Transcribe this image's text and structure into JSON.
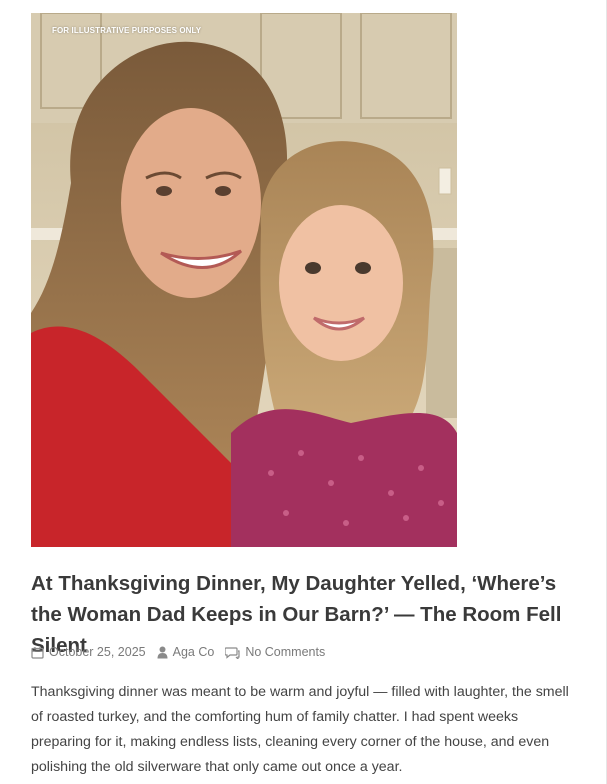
{
  "article": {
    "image_label": "FOR ILLUSTRATIVE PURPOSES ONLY",
    "title": "At Thanksgiving Dinner, My Daughter Yelled, ‘Where’s the Woman Dad Keeps in Our Barn?’ — The Room Fell Silent",
    "meta": {
      "date": "October 25, 2025",
      "author": "Aga Co",
      "comments": "No Comments"
    },
    "excerpt": "Thanksgiving dinner was meant to be warm and joyful — filled with laughter, the smell of roasted turkey, and the comforting hum of family chatter. I had spent weeks preparing for it, making endless lists, cleaning every corner of the house, and even polishing the old silverware that only came out once a year."
  },
  "icons": {
    "date": "calendar-icon",
    "author": "user-icon",
    "comments": "comment-icon"
  },
  "colors": {
    "title": "#3a3a3a",
    "meta": "#7a7a7a",
    "body": "#444444"
  }
}
